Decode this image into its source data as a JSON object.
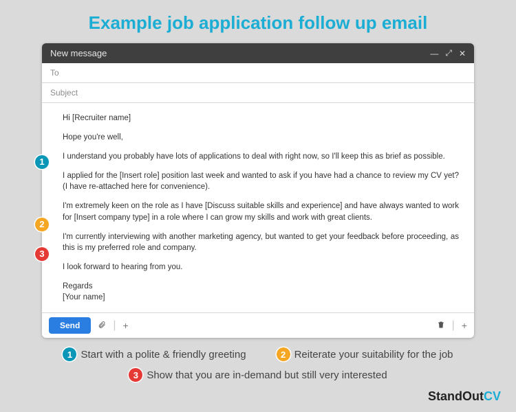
{
  "page_title": "Example job application follow up email",
  "window": {
    "title": "New message",
    "to_placeholder": "To",
    "subject_placeholder": "Subject"
  },
  "email": {
    "greeting": "Hi [Recruiter name]",
    "hope": "Hope you're well,",
    "p1": "I understand you probably have lots of applications to deal with right now, so I'll keep this as brief as possible.",
    "p2": "I applied for the [Insert role] position last week and wanted to ask if you have had a chance to review my CV yet? (I have re-attached here for convenience).",
    "p3": "I'm extremely keen on the role as I have [Discuss suitable skills and experience] and have always wanted to work for [Insert company type] in a role where I can grow my skills and work with great clients.",
    "p4": "I'm currently interviewing with another marketing agency, but wanted to get your feedback before proceeding, as this is my preferred role and company.",
    "p5": "I look forward to hearing from you.",
    "signoff1": "Regards",
    "signoff2": "[Your name]"
  },
  "toolbar": {
    "send": "Send"
  },
  "badges": {
    "n1": "1",
    "n2": "2",
    "n3": "3"
  },
  "legend": {
    "l1": "Start with a polite & friendly greeting",
    "l2": "Reiterate your suitability for the job",
    "l3": "Show that you are in-demand but still very interested"
  },
  "brand": {
    "part1": "StandOut",
    "part2": "CV"
  }
}
